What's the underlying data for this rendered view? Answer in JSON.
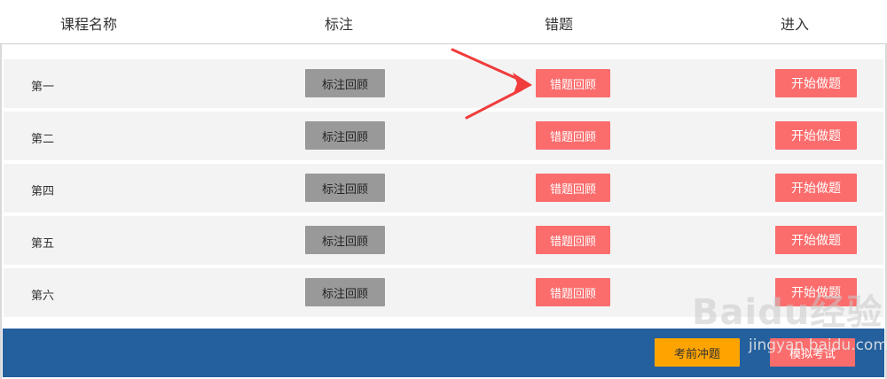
{
  "header": {
    "col_name": "课程名称",
    "col_mark": "标注",
    "col_wrong": "错题",
    "col_enter": "进入"
  },
  "rows": [
    {
      "label": "第一",
      "mark_button": "标注回顾",
      "wrong_button": "错题回顾",
      "start_button": "开始做题"
    },
    {
      "label": "第二",
      "mark_button": "标注回顾",
      "wrong_button": "错题回顾",
      "start_button": "开始做题"
    },
    {
      "label": "第四",
      "mark_button": "标注回顾",
      "wrong_button": "错题回顾",
      "start_button": "开始做题"
    },
    {
      "label": "第五",
      "mark_button": "标注回顾",
      "wrong_button": "错题回顾",
      "start_button": "开始做题"
    },
    {
      "label": "第六",
      "mark_button": "标注回顾",
      "wrong_button": "错题回顾",
      "start_button": "开始做题"
    }
  ],
  "footer": {
    "exam_button": "考前冲题",
    "mock_button": "模拟考试"
  },
  "watermark": {
    "logo_text": "Baidu经验",
    "url_text": "jingyan.baidu.com"
  },
  "colors": {
    "gray_button": "#999999",
    "red_button": "#fb6c6c",
    "orange_button": "#fda400",
    "footer_bar": "#24609d",
    "row_bg": "#f3f3f3",
    "arrow": "#f03c3c"
  }
}
